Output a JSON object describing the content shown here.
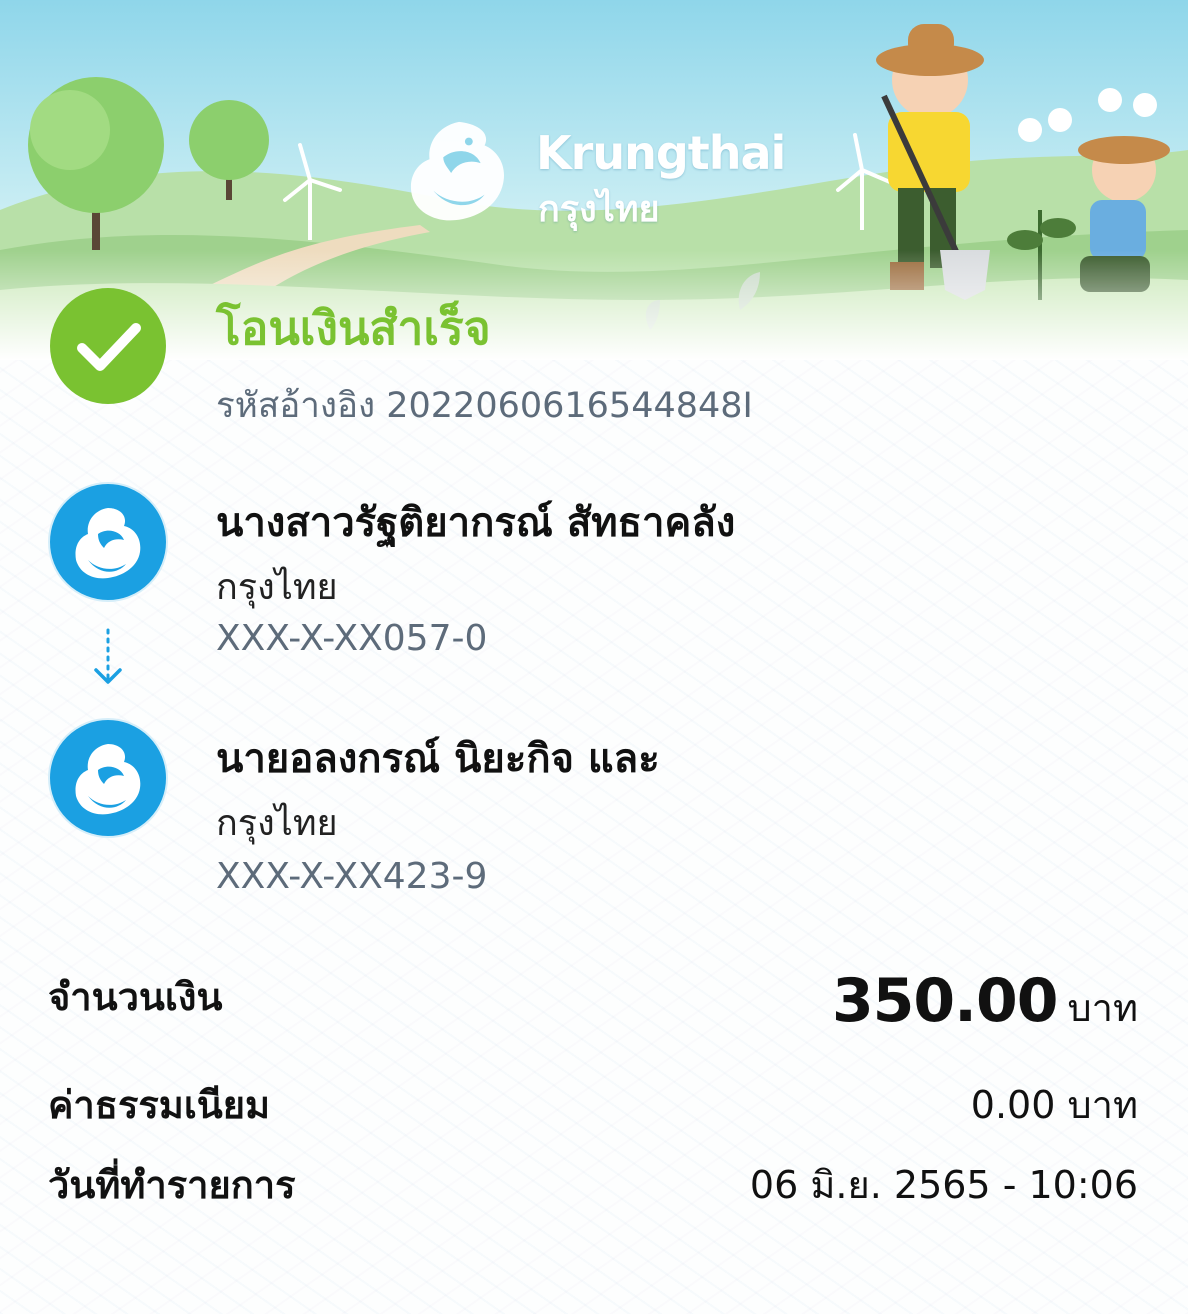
{
  "brand": {
    "name_en": "Krungthai",
    "name_th": "กรุงไทย"
  },
  "status": {
    "title": "โอนเงินสำเร็จ",
    "ref_label": "รหัสอ้างอิง",
    "ref_value": "2022060616544848I",
    "icon": "check-icon",
    "color": "#7ac231"
  },
  "sender": {
    "name": "นางสาวรัฐติยากรณ์ สัทธาคลัง",
    "bank": "กรุงไทย",
    "account": "XXX-X-XX057-0",
    "icon": "krungthai-logo-icon"
  },
  "receiver": {
    "name": "นายอลงกรณ์ นิยะกิจ และ",
    "bank": "กรุงไทย",
    "account": "XXX-X-XX423-9",
    "icon": "krungthai-logo-icon"
  },
  "summary": {
    "amount_label": "จำนวนเงิน",
    "amount_value": "350.00",
    "amount_unit": "บาท",
    "fee_label": "ค่าธรรมเนียม",
    "fee_value": "0.00 บาท",
    "date_label": "วันที่ทำรายการ",
    "date_value": "06 มิ.ย. 2565 - 10:06"
  },
  "colors": {
    "brand_blue": "#1ba0e2",
    "success_green": "#7ac231",
    "muted_text": "#5d6b7a"
  }
}
